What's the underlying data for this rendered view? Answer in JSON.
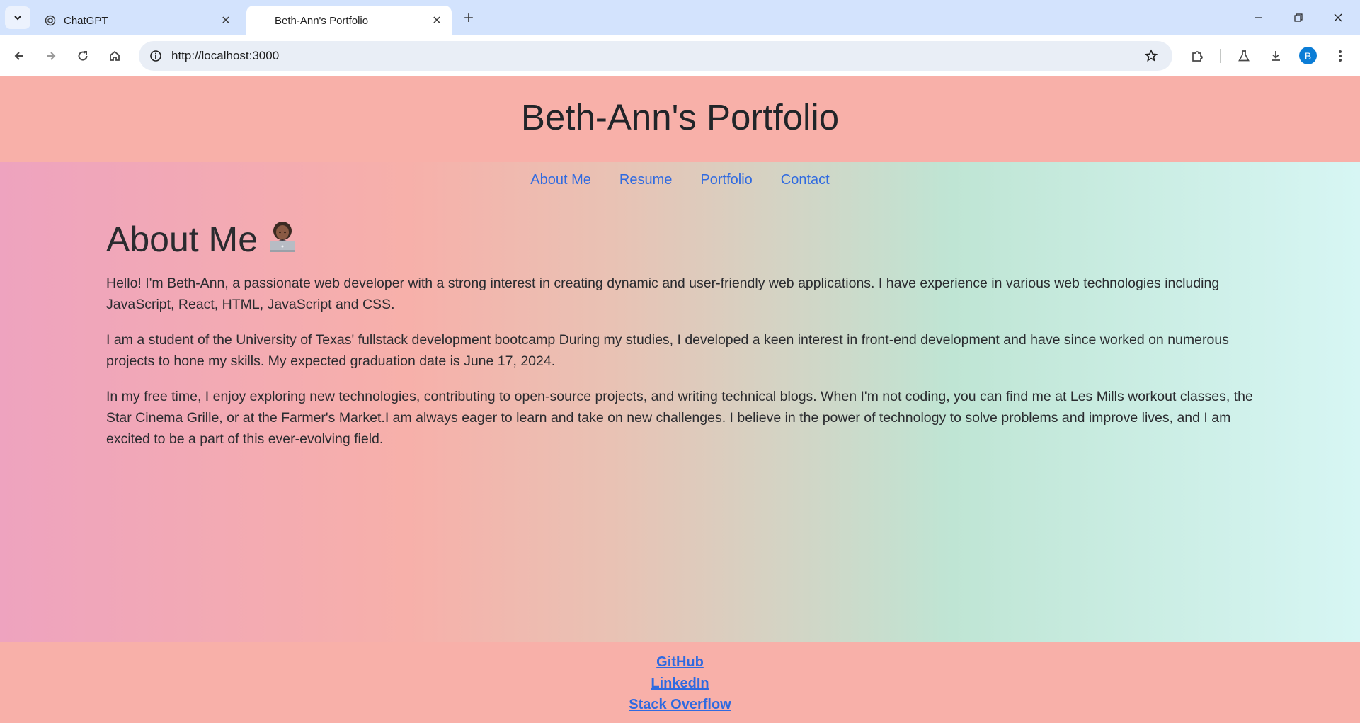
{
  "browser": {
    "tabs": [
      {
        "title": "ChatGPT",
        "active": false
      },
      {
        "title": "Beth-Ann's Portfolio",
        "active": true
      }
    ],
    "url": "http://localhost:3000",
    "profile_initial": "B"
  },
  "site": {
    "title": "Beth-Ann's Portfolio",
    "nav": [
      {
        "label": "About Me"
      },
      {
        "label": "Resume"
      },
      {
        "label": "Portfolio"
      },
      {
        "label": "Contact"
      }
    ],
    "about": {
      "heading": "About Me",
      "emoji": "woman-technologist-emoji",
      "paragraphs": [
        "Hello! I'm Beth-Ann, a passionate web developer with a strong interest in creating dynamic and user-friendly web applications. I have experience in various web technologies including JavaScript, React, HTML, JavaScript and CSS.",
        "I am a student of the University of Texas' fullstack development bootcamp During my studies, I developed a keen interest in front-end development and have since worked on numerous projects to hone my skills. My expected graduation date is June 17, 2024.",
        "In my free time, I enjoy exploring new technologies, contributing to open-source projects, and writing technical blogs. When I'm not coding, you can find me at Les Mills workout classes, the Star Cinema Grille, or at the Farmer's Market.I am always eager to learn and take on new challenges. I believe in the power of technology to solve problems and improve lives, and I am excited to be a part of this ever-evolving field."
      ]
    },
    "footer_links": [
      {
        "label": "GitHub"
      },
      {
        "label": "LinkedIn"
      },
      {
        "label": "Stack Overflow"
      }
    ]
  },
  "colors": {
    "header_bg": "#f8b0a9",
    "link": "#2f6ae0",
    "tabbar_bg": "#d3e3fd"
  }
}
